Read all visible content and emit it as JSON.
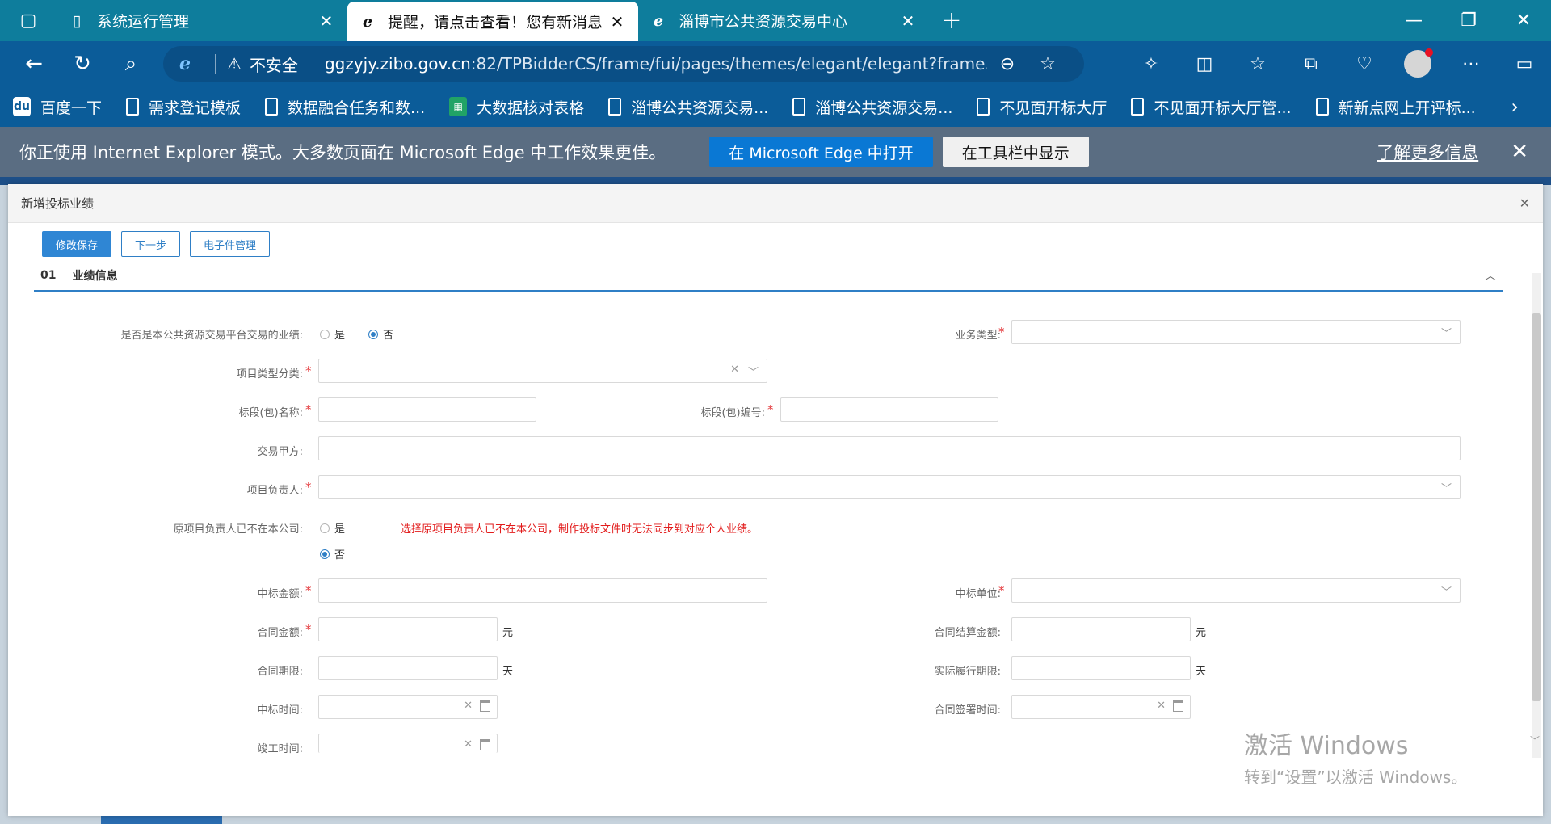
{
  "tabs": [
    {
      "title": "系统运行管理",
      "icon": "page-icon",
      "active": false
    },
    {
      "title": "提醒，请点击查看！您有新消息",
      "icon": "ie-icon",
      "active": true
    },
    {
      "title": "淄博市公共资源交易中心",
      "icon": "ie-icon",
      "active": false
    }
  ],
  "address": {
    "security": "不安全",
    "url_host": "ggzyjy.zibo.gov.cn",
    "url_rest": ":82/TPBidderCS/frame/fui/pages/themes/elegant/elegant?frame..."
  },
  "bookmarks": [
    {
      "label": "百度一下",
      "icon": "baidu-icon"
    },
    {
      "label": "需求登记模板",
      "icon": "page-icon"
    },
    {
      "label": "数据融合任务和数...",
      "icon": "page-icon"
    },
    {
      "label": "大数据核对表格",
      "icon": "sheet-icon"
    },
    {
      "label": "淄博公共资源交易...",
      "icon": "page-icon"
    },
    {
      "label": "淄博公共资源交易...",
      "icon": "page-icon"
    },
    {
      "label": "不见面开标大厅",
      "icon": "page-icon"
    },
    {
      "label": "不见面开标大厅管...",
      "icon": "page-icon"
    },
    {
      "label": "新新点网上开评标...",
      "icon": "page-icon"
    }
  ],
  "iebar": {
    "message": "你正使用 Internet Explorer 模式。大多数页面在 Microsoft Edge 中工作效果更佳。",
    "open_in_edge": "在 Microsoft Edge 中打开",
    "show_in_toolbar": "在工具栏中显示",
    "learn_more": "了解更多信息"
  },
  "dialog": {
    "title": "新增投标业绩",
    "toolbar": {
      "save": "修改保存",
      "next": "下一步",
      "files": "电子件管理"
    },
    "section": {
      "num": "01",
      "title": "业绩信息"
    },
    "form": {
      "is_platform_label": "是否是本公共资源交易平台交易的业绩:",
      "yes": "是",
      "no": "否",
      "is_platform_value": "否",
      "business_type_label": "业务类型:",
      "project_category_label": "项目类型分类:",
      "section_name_label": "标段(包)名称:",
      "section_no_label": "标段(包)编号:",
      "party_a_label": "交易甲方:",
      "project_leader_label": "项目负责人:",
      "leader_left_label": "原项目负责人已不在本公司:",
      "leader_left_value": "否",
      "leader_left_warning": "选择原项目负责人已不在本公司，制作投标文件时无法同步到对应个人业绩。",
      "bid_amount_label": "中标金额:",
      "bid_unit_label": "中标单位:",
      "contract_amount_label": "合同金额:",
      "settlement_amount_label": "合同结算金额:",
      "currency_unit": "元",
      "contract_period_label": "合同期限:",
      "actual_period_label": "实际履行期限:",
      "day_unit": "天",
      "bid_time_label": "中标时间:",
      "sign_time_label": "合同签署时间:",
      "completion_time_label": "竣工时间:"
    }
  },
  "watermark": {
    "line1": "激活 Windows",
    "line2": "转到“设置”以激活 Windows。"
  },
  "colors": {
    "tabbar": "#0e7d9c",
    "addressbar": "#0b5c99",
    "iebar": "#5a6d82",
    "primary": "#2f86d4",
    "required": "#e4393c",
    "warning": "#e21b1b"
  }
}
